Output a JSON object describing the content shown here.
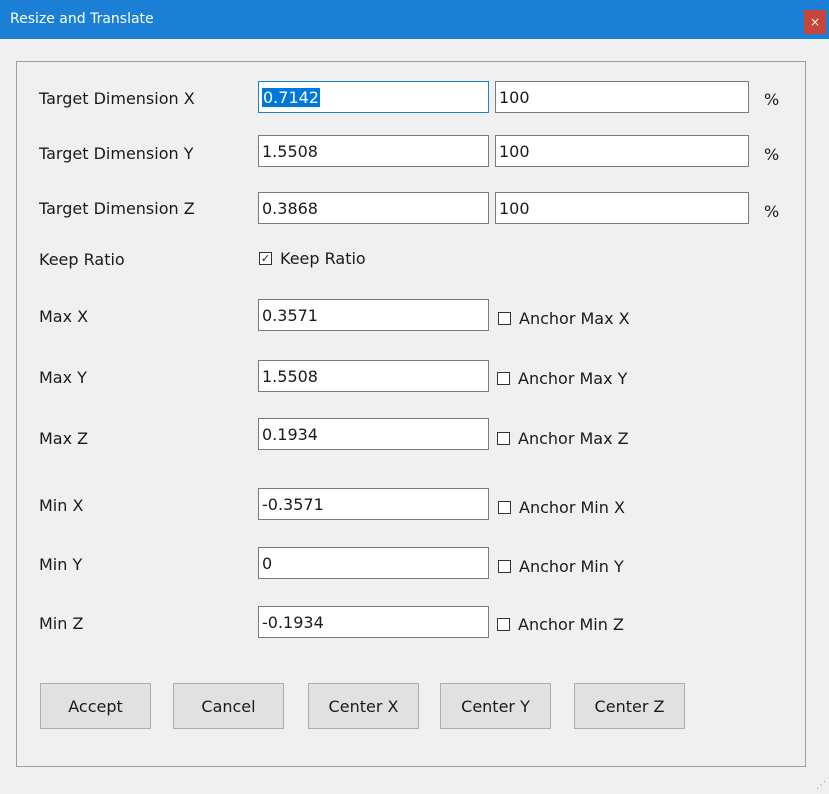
{
  "window": {
    "title": "Resize and Translate",
    "close_glyph": "×"
  },
  "dimensions": [
    {
      "label": "Target Dimension X",
      "value": "0.7142",
      "percent": "100",
      "unit": "%"
    },
    {
      "label": "Target Dimension Y",
      "value": "1.5508",
      "percent": "100",
      "unit": "%"
    },
    {
      "label": "Target Dimension Z",
      "value": "0.3868",
      "percent": "100",
      "unit": "%"
    }
  ],
  "keep_ratio": {
    "label": "Keep Ratio",
    "checkbox_label": "Keep Ratio",
    "checked": true,
    "check_glyph": "✓"
  },
  "max": [
    {
      "label": "Max X",
      "value": "0.3571",
      "anchor_label": "Anchor Max X",
      "checked": false
    },
    {
      "label": "Max Y",
      "value": "1.5508",
      "anchor_label": "Anchor Max Y",
      "checked": false
    },
    {
      "label": "Max Z",
      "value": "0.1934",
      "anchor_label": "Anchor Max Z",
      "checked": false
    }
  ],
  "min": [
    {
      "label": "Min X",
      "value": "-0.3571",
      "anchor_label": "Anchor Min X",
      "checked": false
    },
    {
      "label": "Min Y",
      "value": "0",
      "anchor_label": "Anchor Min Y",
      "checked": false
    },
    {
      "label": "Min Z",
      "value": "-0.1934",
      "anchor_label": "Anchor Min Z",
      "checked": false
    }
  ],
  "buttons": {
    "accept": "Accept",
    "cancel": "Cancel",
    "center_x": "Center X",
    "center_y": "Center Y",
    "center_z": "Center Z"
  },
  "colors": {
    "titlebar": "#1c7fd6",
    "close": "#c8453c",
    "selection": "#0078d7"
  }
}
